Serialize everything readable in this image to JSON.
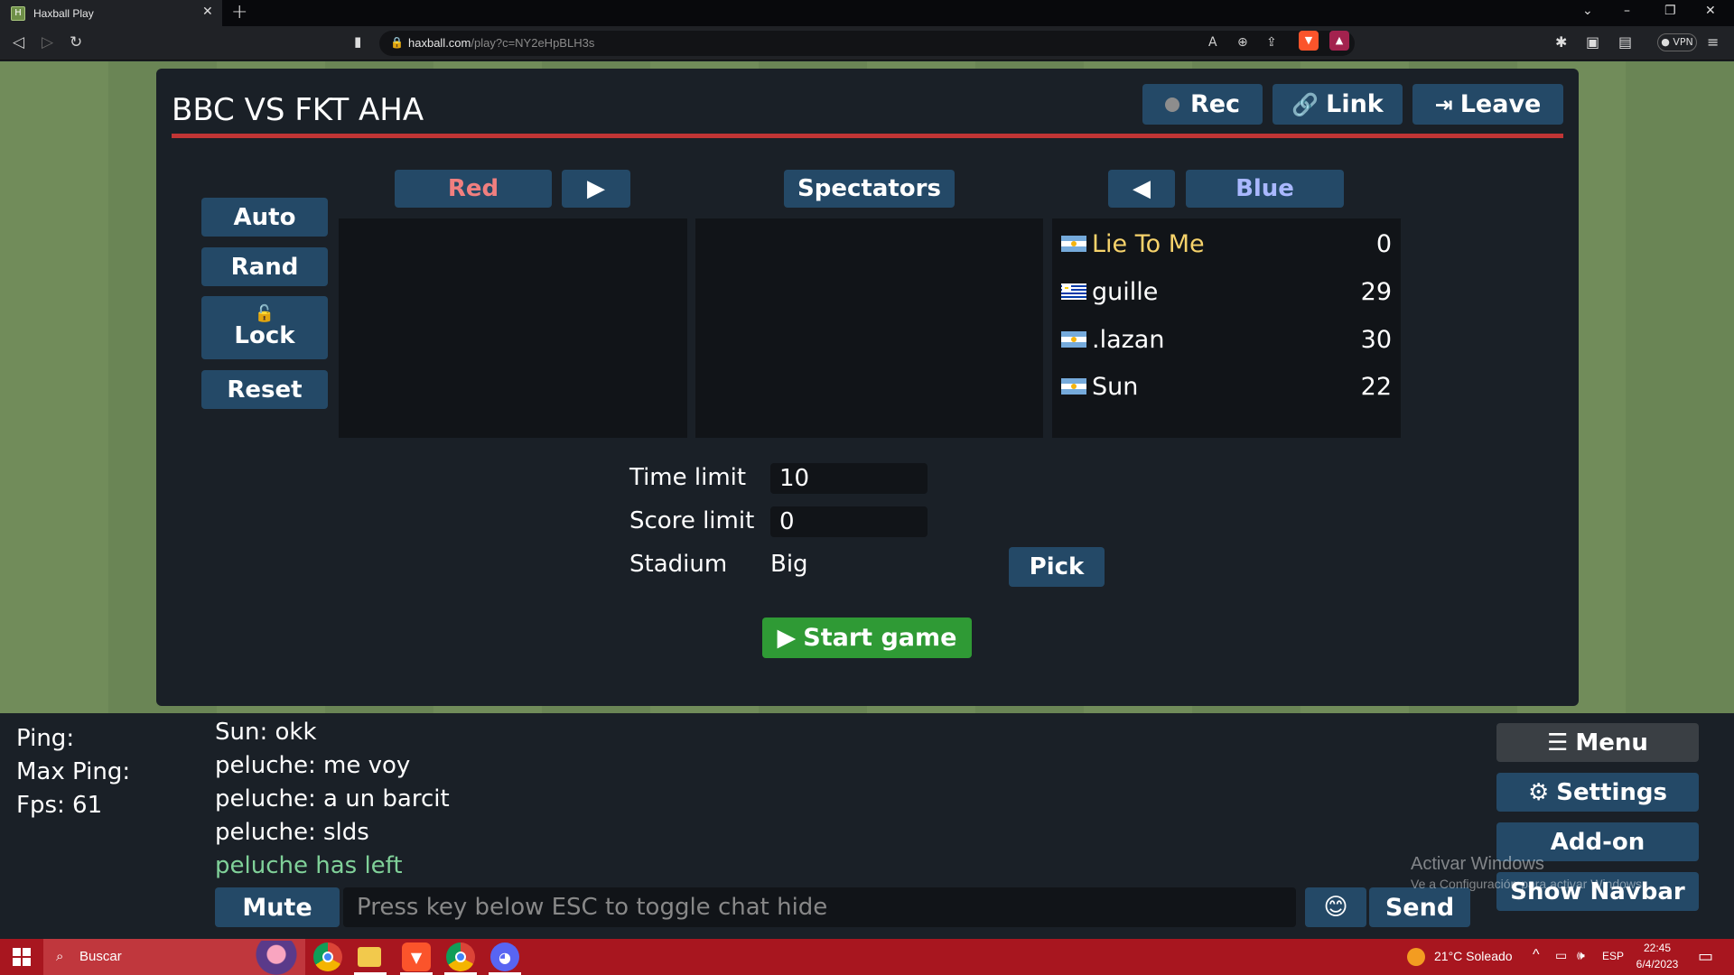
{
  "browser": {
    "tab_title": "Haxball Play",
    "favicon_letter": "H",
    "url_host": "haxball.com",
    "url_path": "/play?c=NY2eHpBLH3s",
    "vpn_label": "VPN"
  },
  "room": {
    "title": "BBC VS FKT AHA",
    "rec_label": "Rec",
    "link_label": "Link",
    "leave_label": "Leave"
  },
  "side_buttons": {
    "auto": "Auto",
    "rand": "Rand",
    "lock": "Lock",
    "reset": "Reset"
  },
  "teams": {
    "red_label": "Red",
    "spectators_label": "Spectators",
    "blue_label": "Blue",
    "move_right_icon": "play-right-icon",
    "move_left_icon": "play-left-icon"
  },
  "blue_players": [
    {
      "name": "Lie To Me",
      "ping": "0",
      "flag": "argentina-flag",
      "highlight_color": "#f7d36b"
    },
    {
      "name": "guille",
      "ping": "29",
      "flag": "uruguay-flag"
    },
    {
      "name": ".lazan",
      "ping": "30",
      "flag": "argentina-flag"
    },
    {
      "name": "Sun",
      "ping": "22",
      "flag": "argentina-flag"
    }
  ],
  "settings": {
    "time_limit_label": "Time limit",
    "time_limit_value": "10",
    "score_limit_label": "Score limit",
    "score_limit_value": "0",
    "stadium_label": "Stadium",
    "stadium_value": "Big",
    "pick_label": "Pick"
  },
  "start_game_label": "Start game",
  "stats": {
    "ping_label": "Ping:",
    "max_ping_label": "Max Ping:",
    "fps_label": "Fps: 61"
  },
  "chat": {
    "messages": [
      {
        "text": "Sun: okk",
        "type": "user"
      },
      {
        "text": "peluche: me voy",
        "type": "user"
      },
      {
        "text": "peluche: a un barcit",
        "type": "user"
      },
      {
        "text": "peluche: slds",
        "type": "user"
      },
      {
        "text": "peluche has left",
        "type": "system"
      }
    ],
    "mute_label": "Mute",
    "input_placeholder": "Press key below ESC to toggle chat hide",
    "emoji": "😊",
    "send_label": "Send"
  },
  "right_menu": {
    "menu_label": "Menu",
    "settings_label": "Settings",
    "addon_label": "Add-on",
    "show_navbar_label": "Show Navbar"
  },
  "watermark": {
    "line1": "Activar Windows",
    "line2": "Ve a Configuración para activar Windows."
  },
  "taskbar": {
    "search_label": "Buscar",
    "weather": "21°C  Soleado",
    "lang": "ESP",
    "time": "22:45",
    "date": "6/4/2023"
  },
  "colors": {
    "accent_blue_button": "#244967",
    "red_team_text": "#f07f7f",
    "blue_team_text": "#a9b8ff",
    "start_green": "#2f9a35",
    "room_red_line": "#c13535",
    "system_message": "#80d199"
  }
}
